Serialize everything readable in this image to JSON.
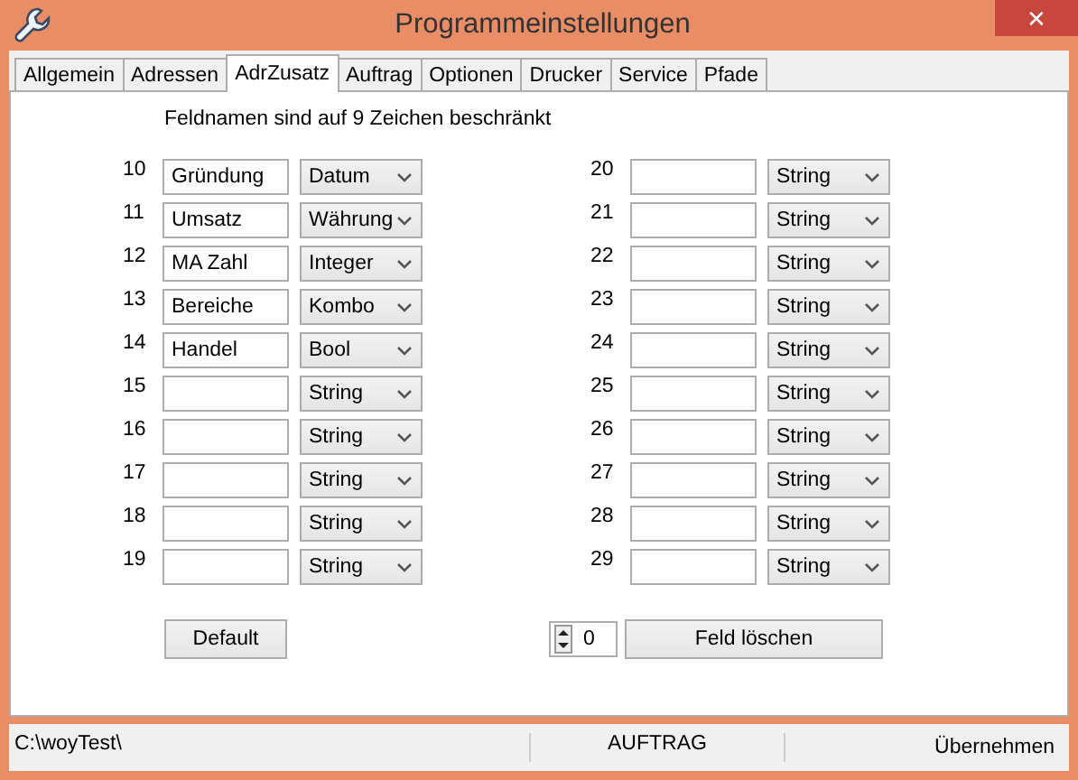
{
  "window": {
    "title": "Programmeinstellungen",
    "close": "✕"
  },
  "tabs": [
    {
      "label": "Allgemein",
      "selected": false
    },
    {
      "label": "Adressen",
      "selected": false
    },
    {
      "label": "AdrZusatz",
      "selected": true
    },
    {
      "label": "Auftrag",
      "selected": false
    },
    {
      "label": "Optionen",
      "selected": false
    },
    {
      "label": "Drucker",
      "selected": false
    },
    {
      "label": "Service",
      "selected": false
    },
    {
      "label": "Pfade",
      "selected": false
    }
  ],
  "hint": "Feldnamen sind auf 9 Zeichen beschränkt",
  "left_fields": [
    {
      "number": "10",
      "value": "Gründung",
      "type": "Datum"
    },
    {
      "number": "11",
      "value": "Umsatz",
      "type": "Währung"
    },
    {
      "number": "12",
      "value": "MA Zahl",
      "type": "Integer"
    },
    {
      "number": "13",
      "value": "Bereiche",
      "type": "Kombo"
    },
    {
      "number": "14",
      "value": "Handel",
      "type": "Bool"
    },
    {
      "number": "15",
      "type": "String"
    },
    {
      "number": "16",
      "type": "String"
    },
    {
      "number": "17",
      "type": "String"
    },
    {
      "number": "18",
      "type": "String"
    },
    {
      "number": "19",
      "type": "String"
    }
  ],
  "right_fields": [
    {
      "number": "20",
      "type": "String"
    },
    {
      "number": "21",
      "type": "String"
    },
    {
      "number": "22",
      "type": "String"
    },
    {
      "number": "23",
      "type": "String"
    },
    {
      "number": "24",
      "type": "String"
    },
    {
      "number": "25",
      "type": "String"
    },
    {
      "number": "26",
      "type": "String"
    },
    {
      "number": "27",
      "type": "String"
    },
    {
      "number": "28",
      "type": "String"
    },
    {
      "number": "29",
      "type": "String"
    }
  ],
  "default_button": "Default",
  "spinner": {
    "value": "0"
  },
  "delete_button": "Feld löschen",
  "status_bar": {
    "path": "C:\\woyTest\\",
    "module": "AUFTRAG",
    "apply": "Übernehmen"
  }
}
